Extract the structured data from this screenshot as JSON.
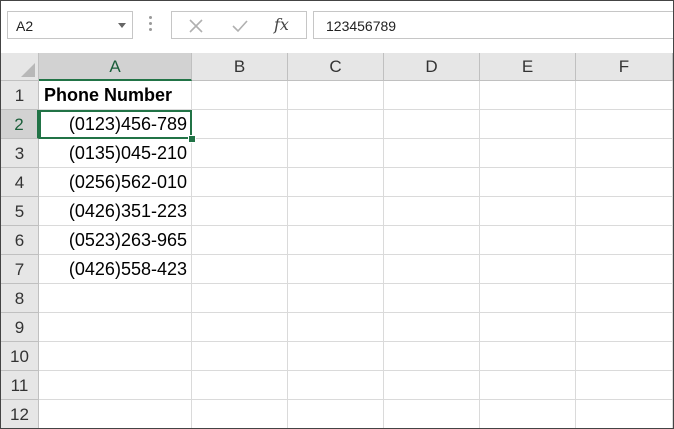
{
  "formula_bar": {
    "name_box": "A2",
    "formula_value": "123456789",
    "fx_label": "fx"
  },
  "columns": [
    "A",
    "B",
    "C",
    "D",
    "E",
    "F"
  ],
  "active_column": "A",
  "rows": [
    "1",
    "2",
    "3",
    "4",
    "5",
    "6",
    "7",
    "8",
    "9",
    "10",
    "11",
    "12"
  ],
  "active_row": "2",
  "cells": {
    "A1": "Phone Number",
    "A2": "(0123)456-789",
    "A3": "(0135)045-210",
    "A4": "(0256)562-010",
    "A5": "(0426)351-223",
    "A6": "(0523)263-965",
    "A7": "(0426)558-423"
  },
  "colors": {
    "selection": "#217346",
    "header_bg": "#e6e6e6",
    "gridline": "#dadada"
  },
  "icons": {
    "cancel": "close-icon",
    "enter": "check-icon",
    "insert_function": "fx-icon",
    "name_box_dropdown": "chevron-down-icon"
  }
}
